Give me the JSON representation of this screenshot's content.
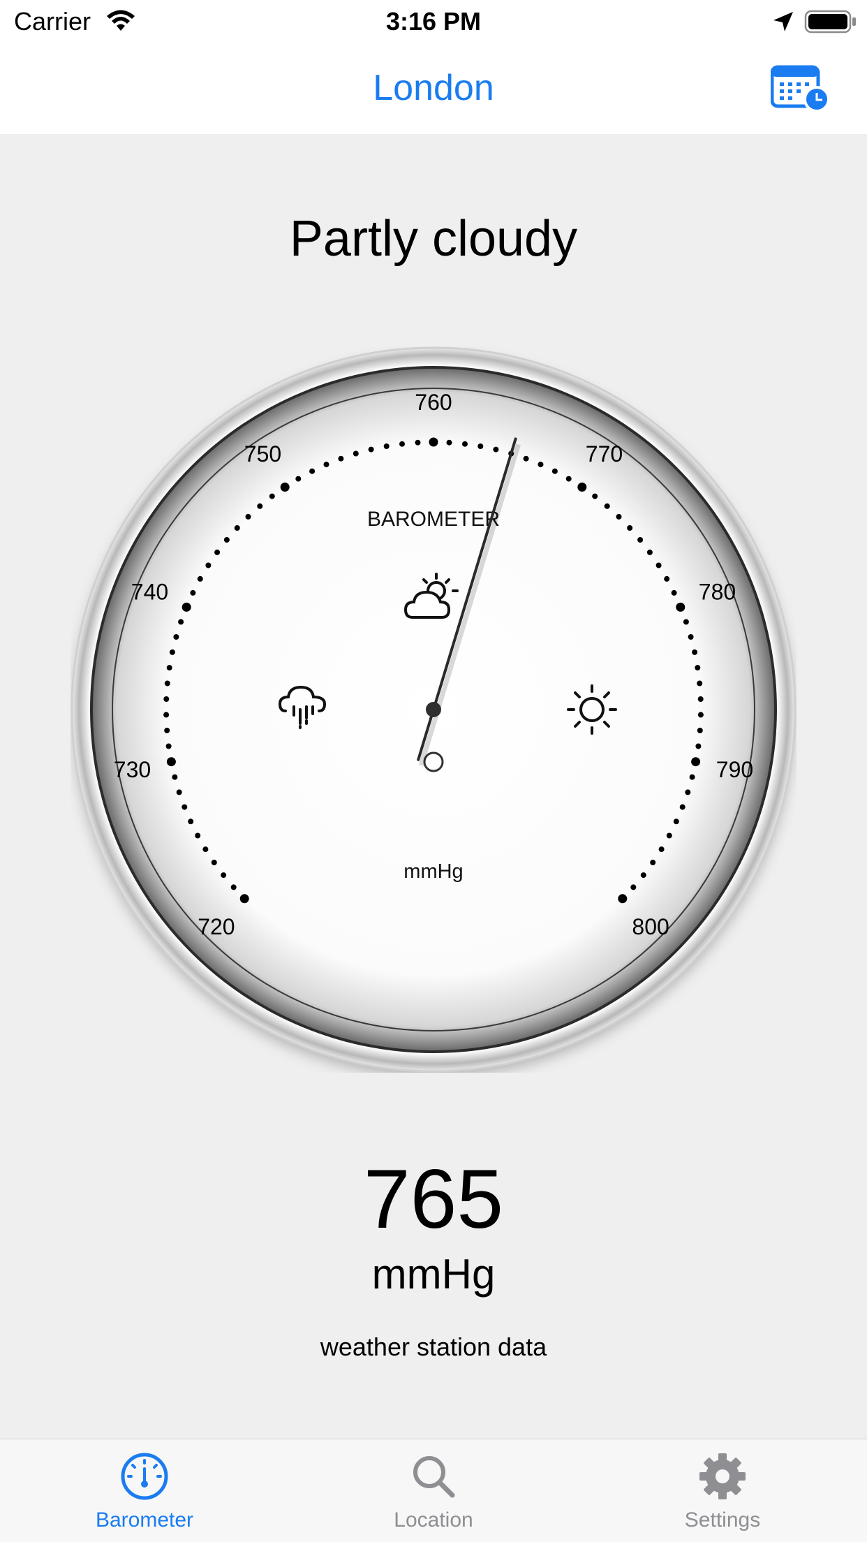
{
  "status_bar": {
    "carrier": "Carrier",
    "time": "3:16 PM",
    "wifi_icon": "wifi-icon",
    "location_icon": "location-arrow-icon",
    "battery_icon": "battery-full-icon"
  },
  "nav": {
    "title": "London",
    "calendar_icon": "calendar-clock-icon"
  },
  "main": {
    "condition": "Partly cloudy",
    "pressure_value": "765",
    "pressure_unit": "mmHg",
    "data_source": "weather station data"
  },
  "gauge": {
    "title": "BAROMETER",
    "unit": "mmHg",
    "scale_min": 720,
    "scale_max": 800,
    "scale_labels": [
      "720",
      "730",
      "740",
      "750",
      "760",
      "770",
      "780",
      "790",
      "800"
    ],
    "needle_value": 765,
    "reference_value": 760,
    "icons": [
      "rain-cloud-icon",
      "partly-cloudy-icon",
      "sun-icon"
    ]
  },
  "tabs": [
    {
      "label": "Barometer",
      "icon": "gauge-icon",
      "active": true
    },
    {
      "label": "Location",
      "icon": "search-icon",
      "active": false
    },
    {
      "label": "Settings",
      "icon": "gear-icon",
      "active": false
    }
  ],
  "colors": {
    "accent": "#1a7cf0",
    "inactive_tab": "#8e8e93",
    "background": "#efeff0"
  }
}
